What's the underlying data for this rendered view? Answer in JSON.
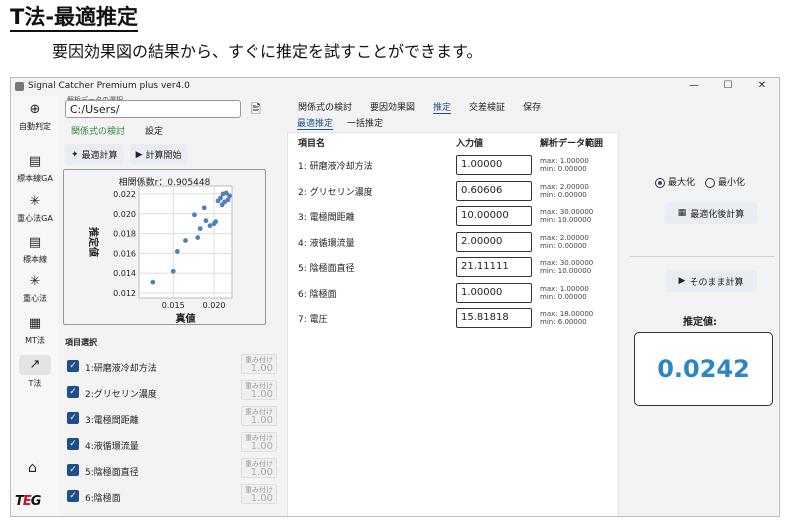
{
  "slide": {
    "title": "T法-最適推定",
    "subtitle": "要因効果図の結果から、すぐに推定を試すことができます。"
  },
  "window": {
    "title": "Signal Catcher Premium plus ver4.0",
    "controls": [
      "—",
      "☐",
      "✕"
    ]
  },
  "nav": {
    "items": [
      {
        "label": "自動判定",
        "icon": "target-icon",
        "glyph": "⊕"
      },
      {
        "label": "標本線GA",
        "icon": "table-icon",
        "glyph": "▤"
      },
      {
        "label": "重心法GA",
        "icon": "asterisk-icon",
        "glyph": "✳"
      },
      {
        "label": "標本線",
        "icon": "table-icon",
        "glyph": "▤"
      },
      {
        "label": "重心法",
        "icon": "asterisk-icon",
        "glyph": "✳"
      },
      {
        "label": "MT法",
        "icon": "grid-icon",
        "glyph": "▦"
      },
      {
        "label": "T法",
        "icon": "trend-icon",
        "glyph": "↗"
      }
    ],
    "active_index": 6,
    "home_glyph": "⌂",
    "logo_text": "TEG"
  },
  "left": {
    "file_label": "解析データの選択",
    "file_path": "C:/Users/",
    "tabs": [
      "関係式の検討",
      "設定"
    ],
    "active_tab": 0,
    "buttons": {
      "best_calc": "最適計算",
      "start_calc": "計算開始"
    },
    "items_label": "項目選択",
    "weight_label": "重み付け",
    "items": [
      {
        "name": "1:研磨液冷却方法",
        "weight": "1.00",
        "checked": true
      },
      {
        "name": "2:グリセリン濃度",
        "weight": "1.00",
        "checked": true
      },
      {
        "name": "3:電極間距離",
        "weight": "1.00",
        "checked": true
      },
      {
        "name": "4:液循環流量",
        "weight": "1.00",
        "checked": true
      },
      {
        "name": "5:陰極面直径",
        "weight": "1.00",
        "checked": true
      },
      {
        "name": "6:陰極面",
        "weight": "1.00",
        "checked": true
      }
    ]
  },
  "chart_data": {
    "type": "scatter",
    "title": "相関係数r：0.905448",
    "xlabel": "真値",
    "ylabel": "推定値",
    "xlim": [
      0.0108,
      0.0222
    ],
    "ylim": [
      0.0115,
      0.0228
    ],
    "x_ticks": [
      "0.015",
      "0.020"
    ],
    "y_ticks": [
      "0.012",
      "0.014",
      "0.016",
      "0.018",
      "0.020",
      "0.022"
    ],
    "grid": true,
    "color": "#4f81bd",
    "points": [
      [
        0.0125,
        0.0131
      ],
      [
        0.015,
        0.0142
      ],
      [
        0.0155,
        0.0162
      ],
      [
        0.0165,
        0.0173
      ],
      [
        0.018,
        0.0176
      ],
      [
        0.0183,
        0.0185
      ],
      [
        0.019,
        0.0193
      ],
      [
        0.0195,
        0.0188
      ],
      [
        0.02,
        0.019
      ],
      [
        0.0202,
        0.0192
      ],
      [
        0.0176,
        0.0199
      ],
      [
        0.0188,
        0.0206
      ],
      [
        0.0205,
        0.0213
      ],
      [
        0.0208,
        0.0216
      ],
      [
        0.021,
        0.0209
      ],
      [
        0.0213,
        0.0212
      ],
      [
        0.0215,
        0.0221
      ],
      [
        0.0217,
        0.0214
      ],
      [
        0.0219,
        0.0218
      ],
      [
        0.0211,
        0.022
      ]
    ]
  },
  "main": {
    "tabs": [
      "関係式の検討",
      "要因効果図",
      "推定",
      "交差検証",
      "保存"
    ],
    "active_tab": 2,
    "subtabs": [
      "最適推定",
      "一括推定"
    ],
    "active_subtab": 0,
    "table": {
      "headers": [
        "項目名",
        "入力値",
        "解析データ範囲"
      ],
      "rows": [
        {
          "name": "1: 研磨液冷却方法",
          "value": "1.00000",
          "max": "max: 1.00000",
          "min": "min: 0.00000"
        },
        {
          "name": "2: グリセリン濃度",
          "value": "0.60606",
          "max": "max: 2.00000",
          "min": "min: 0.00000"
        },
        {
          "name": "3: 電極間距離",
          "value": "10.00000",
          "max": "max: 30.00000",
          "min": "min: 10.00000"
        },
        {
          "name": "4: 液循環流量",
          "value": "2.00000",
          "max": "max: 2.00000",
          "min": "min: 0.00000"
        },
        {
          "name": "5: 陰極面直径",
          "value": "21.11111",
          "max": "max: 30.00000",
          "min": "min: 10.00000"
        },
        {
          "name": "6: 陰極面",
          "value": "1.00000",
          "max": "max: 1.00000",
          "min": "min: 0.00000"
        },
        {
          "name": "7: 電圧",
          "value": "15.81818",
          "max": "max: 18.00000",
          "min": "min: 6.00000"
        }
      ]
    },
    "right": {
      "maximize_label": "最大化",
      "minimize_label": "最小化",
      "mode": "maximize",
      "optimize_btn": "最適化後計算",
      "calc_btn": "そのまま計算",
      "estimate_label": "推定値:",
      "estimate_value": "0.0242"
    }
  }
}
